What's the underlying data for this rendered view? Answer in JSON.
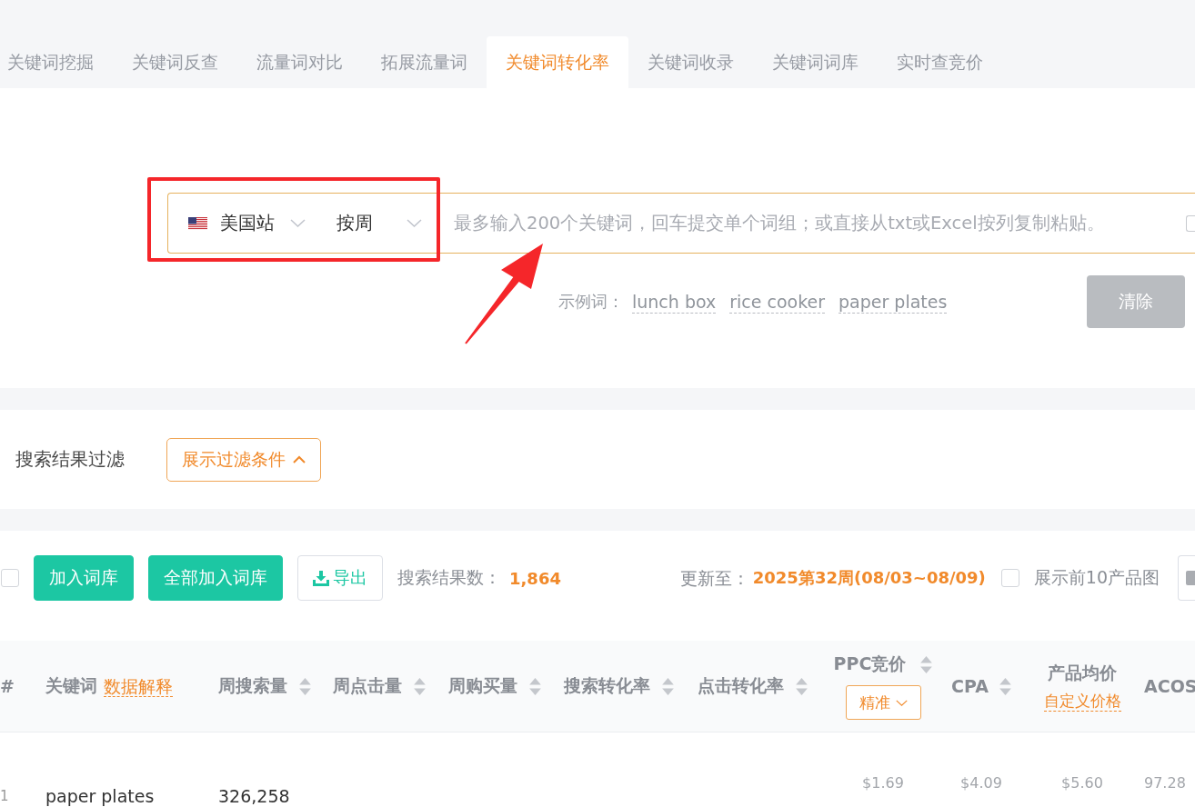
{
  "tabs": [
    {
      "label": "关键词挖掘",
      "selected": false
    },
    {
      "label": "关键词反查",
      "selected": false
    },
    {
      "label": "流量词对比",
      "selected": false
    },
    {
      "label": "拓展流量词",
      "selected": false
    },
    {
      "label": "关键词转化率",
      "selected": true
    },
    {
      "label": "关键词收录",
      "selected": false
    },
    {
      "label": "关键词词库",
      "selected": false
    },
    {
      "label": "实时查竞价",
      "selected": false
    }
  ],
  "search": {
    "site": "美国站",
    "period": "按周",
    "placeholder": "最多输入200个关键词，回车提交单个词组；或直接从txt或Excel按列复制粘贴。",
    "option_checked": false,
    "examples_label": "示例词：",
    "examples": [
      "lunch box",
      "rice cooker",
      "paper plates"
    ],
    "clear_button": "清除"
  },
  "filter": {
    "label": "搜索结果过滤",
    "toggle": "展示过滤条件"
  },
  "toolbar": {
    "select_all_checked": false,
    "buttons": [
      {
        "label": "加入词库",
        "kind": "add"
      },
      {
        "label": "全部加入词库",
        "kind": "add_all"
      },
      {
        "label": "导出",
        "kind": "export"
      }
    ],
    "result_count_label": "搜索结果数：",
    "result_count": "1,864",
    "updated_label": "更新至：",
    "updated_value": "2025第32周(08/03~08/09)",
    "show_images": {
      "label": "展示前10产品图",
      "checked": false
    }
  },
  "table": {
    "columns": [
      {
        "label": "#",
        "kind": "plain"
      },
      {
        "label": "关键词",
        "kind": "keyword",
        "link": "数据解释"
      },
      {
        "label": "周搜索量",
        "kind": "sort"
      },
      {
        "label": "周点击量",
        "kind": "sort"
      },
      {
        "label": "周购买量",
        "kind": "sort"
      },
      {
        "label": "搜索转化率",
        "kind": "sort"
      },
      {
        "label": "点击转化率",
        "kind": "sort"
      },
      {
        "label": "PPC竞价",
        "kind": "bid",
        "dropdown": "精准"
      },
      {
        "label": "CPA",
        "kind": "sort"
      },
      {
        "label": "产品均价",
        "kind": "price",
        "link": "自定义价格"
      },
      {
        "label": "ACOS",
        "kind": "plain"
      }
    ],
    "rows": [
      {
        "index": "1",
        "keyword": "paper plates",
        "weekly_searches": "326,258",
        "ppc_bid": "$1.69",
        "cpa": "$4.09",
        "avg_price": "$5.60",
        "acos": "97.28"
      }
    ]
  }
}
